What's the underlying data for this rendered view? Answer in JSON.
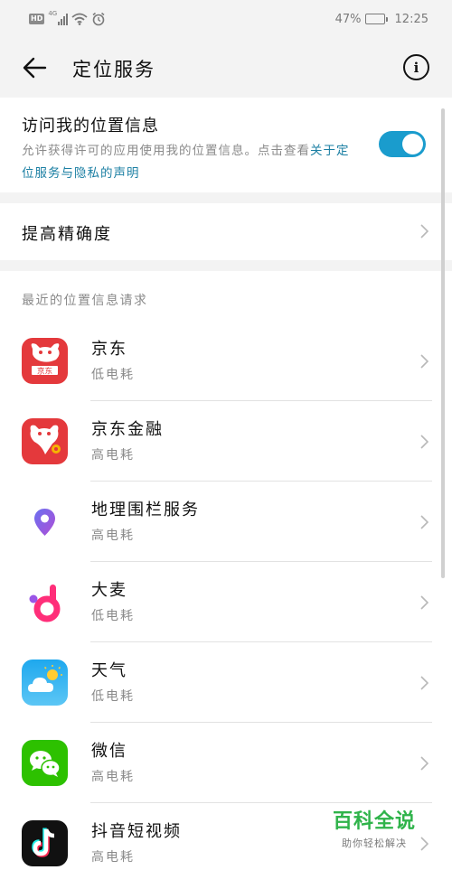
{
  "status_bar": {
    "hd": "HD",
    "network": "4G",
    "battery_text": "47%",
    "battery_level": 0.47,
    "time": "12:25"
  },
  "header": {
    "title": "定位服务",
    "back_icon": "arrow-left-icon",
    "info_icon": "info-circle-icon"
  },
  "location_access": {
    "title": "访问我的位置信息",
    "description": "允许获得许可的应用使用我的位置信息。点击查看",
    "link_text": "关于定位服务与隐私的声明",
    "toggle_on": true,
    "toggle_color": "#1a9ccd"
  },
  "accuracy": {
    "label": "提高精确度"
  },
  "recent": {
    "header": "最近的位置信息请求",
    "apps": [
      {
        "name": "京东",
        "power": "低电耗",
        "icon": "jd-icon"
      },
      {
        "name": "京东金融",
        "power": "高电耗",
        "icon": "jd-finance-icon"
      },
      {
        "name": "地理围栏服务",
        "power": "高电耗",
        "icon": "geofence-pin-icon"
      },
      {
        "name": "大麦",
        "power": "低电耗",
        "icon": "damai-icon"
      },
      {
        "name": "天气",
        "power": "低电耗",
        "icon": "weather-icon"
      },
      {
        "name": "微信",
        "power": "高电耗",
        "icon": "wechat-icon"
      },
      {
        "name": "抖音短视频",
        "power": "高电耗",
        "icon": "douyin-icon"
      }
    ]
  },
  "watermark": {
    "main": "百科全说",
    "sub": "助你轻松解决"
  }
}
